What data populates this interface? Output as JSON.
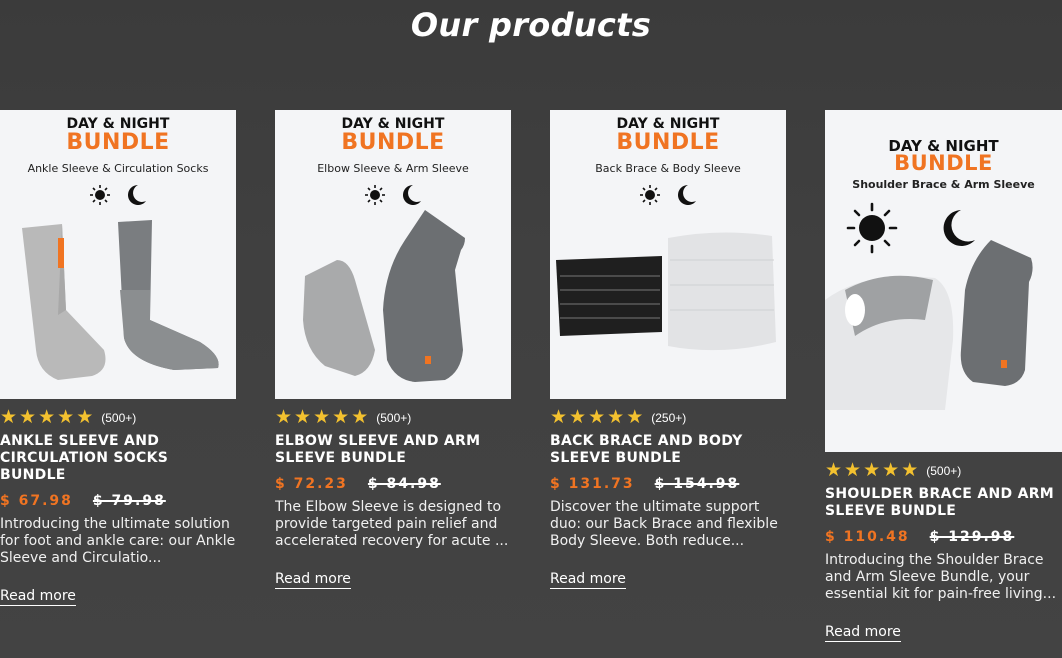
{
  "section": {
    "title": "Our products"
  },
  "products": [
    {
      "thumb": {
        "line1": "DAY & NIGHT",
        "line2": "BUNDLE",
        "subtitle": "Ankle Sleeve & Circulation Socks"
      },
      "rating_count": "(500+)",
      "stars": 5,
      "name": "ANKLE SLEEVE AND CIRCULATION SOCKS BUNDLE",
      "price": "$ 67.98",
      "old_price": "$ 79.98",
      "description": "Introducing the ultimate solution for foot and ankle care: our Ankle Sleeve and Circulatio...",
      "read_more": "Read more"
    },
    {
      "thumb": {
        "line1": "DAY & NIGHT",
        "line2": "BUNDLE",
        "subtitle": "Elbow Sleeve & Arm Sleeve"
      },
      "rating_count": "(500+)",
      "stars": 5,
      "name": "ELBOW SLEEVE AND ARM SLEEVE BUNDLE",
      "price": "$ 72.23",
      "old_price": "$ 84.98",
      "description": "The Elbow Sleeve is designed to provide targeted pain relief and accelerated recovery for acute ...",
      "read_more": "Read more"
    },
    {
      "thumb": {
        "line1": "DAY & NIGHT",
        "line2": "BUNDLE",
        "subtitle": "Back Brace & Body Sleeve"
      },
      "rating_count": "(250+)",
      "stars": 5,
      "name": "BACK BRACE AND BODY SLEEVE BUNDLE",
      "price": "$ 131.73",
      "old_price": "$ 154.98",
      "description": "Discover the ultimate support duo: our Back Brace and flexible Body Sleeve. Both reduce...",
      "read_more": "Read more"
    },
    {
      "thumb": {
        "line1": "DAY & NIGHT",
        "line2": "BUNDLE",
        "subtitle": "Shoulder Brace & Arm Sleeve"
      },
      "rating_count": "(500+)",
      "stars": 5,
      "name": "SHOULDER BRACE AND ARM SLEEVE BUNDLE",
      "price": "$ 110.48",
      "old_price": "$ 129.98",
      "description": "Introducing the Shoulder Brace and Arm Sleeve Bundle, your essential kit for pain-free living...",
      "read_more": "Read more"
    }
  ],
  "colors": {
    "accent": "#f07422",
    "star": "#f3c12f",
    "background": "#3d3d3d",
    "thumb_bg": "#f4f5f7"
  },
  "icons": [
    "sun-icon",
    "moon-icon",
    "star-icon"
  ]
}
